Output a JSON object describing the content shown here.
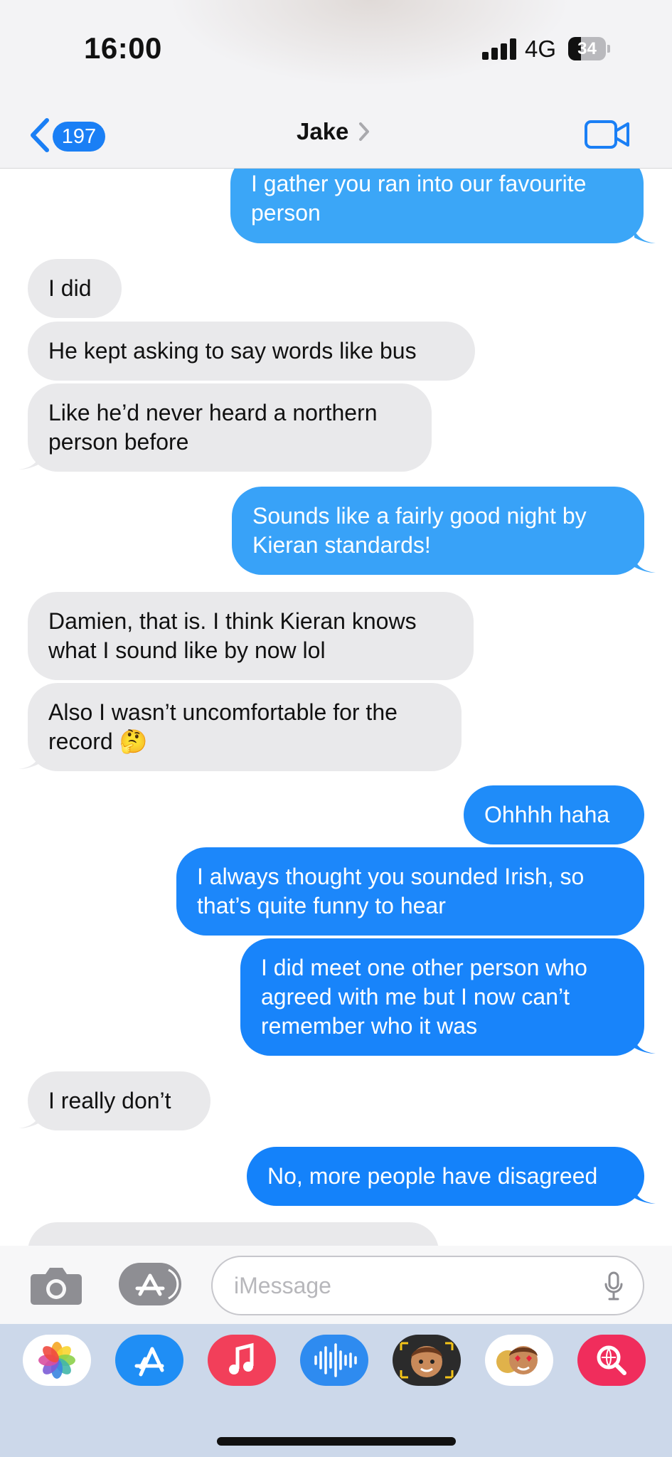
{
  "status_bar": {
    "time": "16:00",
    "network": "4G",
    "battery": "34",
    "battery_level": 0.34
  },
  "header": {
    "back_badge": "197",
    "contact_name": "Jake"
  },
  "messages": [
    {
      "from": "me",
      "text": "I gather you ran into our favourite person"
    },
    {
      "from": "them",
      "text": "I did"
    },
    {
      "from": "them",
      "text": "He kept asking to say words like bus"
    },
    {
      "from": "them",
      "text": "Like he’d never heard a northern person before"
    },
    {
      "from": "me",
      "text": "Sounds like a fairly good night by Kieran standards!"
    },
    {
      "from": "them",
      "text": "Damien, that is. I think Kieran knows what I sound like by now lol"
    },
    {
      "from": "them",
      "text": "Also I wasn’t uncomfortable for the record 🤔"
    },
    {
      "from": "me",
      "text": "Ohhhh haha"
    },
    {
      "from": "me",
      "text": "I always thought you sounded Irish, so that’s quite funny to hear"
    },
    {
      "from": "me",
      "text": "I did meet one other person who agreed with me but I now can’t remember who it was"
    },
    {
      "from": "them",
      "text": "I really don’t"
    },
    {
      "from": "me",
      "text": "No, more people have disagreed"
    }
  ],
  "composer": {
    "placeholder": "iMessage"
  },
  "app_drawer": [
    "photos-icon",
    "app-store-icon",
    "music-icon",
    "audio-message-icon",
    "memoji-icon",
    "stickers-icon",
    "image-search-icon"
  ],
  "colors": {
    "accent": "#1a7ff5",
    "incoming_bubble": "#e9e9eb",
    "outgoing_top": "#3ba6f7",
    "outgoing_bottom": "#1482fa"
  }
}
